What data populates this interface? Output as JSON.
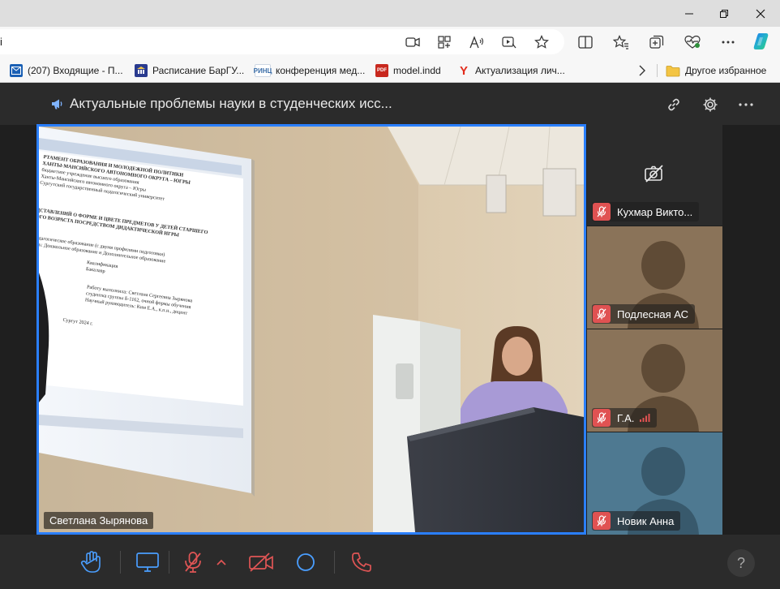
{
  "browser": {
    "address_text": "i",
    "window_controls": [
      "minimize",
      "maximize",
      "close"
    ],
    "toolbar_icons": [
      "video-icon",
      "apps-icon",
      "read-aloud-icon",
      "media-icon",
      "favorite-star-icon",
      "split-screen-icon",
      "favorites-icon",
      "collections-icon",
      "heart-pulse-icon",
      "more-icon",
      "copilot-icon"
    ]
  },
  "favorites": [
    {
      "label": "(207) Входящие - П...",
      "icon": "mail-icon",
      "color": "#1a5fb4"
    },
    {
      "label": "Расписание БарГУ...",
      "icon": "university-icon",
      "color": "#2a3b8f"
    },
    {
      "label": "конференция мед...",
      "icon": "rinc-icon",
      "color": "#3b6ea8"
    },
    {
      "label": "model.indd",
      "icon": "pdf-icon",
      "color": "#c8281e"
    },
    {
      "label": "Актуализация лич...",
      "icon": "yandex-icon",
      "color": "#e22b1b"
    }
  ],
  "favorites_other": "Другое избранное",
  "conference": {
    "title": "Актуальные проблемы науки в студенческих исс...",
    "accent": "#2a7fff"
  },
  "main_speaker": {
    "name": "Светлана Зырянова"
  },
  "slide_text": {
    "line1": "РТАМЕНТ ОБРАЗОВАНИЯ И МОЛОДЕЖНОЙ ПОЛИТИКИ",
    "line2": "ХАНТЫ-МАНСИЙСКОГО АВТОНОМНОГО ОКРУГА – ЮГРЫ",
    "line3": "бюджетное учреждение высшего образования",
    "line4": "Ханты-Мансийского автономного округа – Югры",
    "line5": "Сургутский государственный педагогический университет",
    "heading1": "ДСТАВЛЕНИЙ О ФОРМЕ И ЦВЕТЕ ПРЕДМЕТОВ У ДЕТЕЙ СТАРШЕГО",
    "heading2": "ОГО ВОЗРАСТА ПОСРЕДСТВОМ ДИДАКТИЧЕСКОЙ ИГРЫ",
    "line6": "Педагогическое образование (с двумя профилями подготовки)",
    "line7": "ость: Дошкольное образование и Дополнительное образование",
    "line8": "Квалификация",
    "line9": "Бакалавр",
    "line10": "Работу выполнила: Светлана Сергеевна Зырянова",
    "line11": "студентка группы Б-1162, очной формы обучения",
    "line12": "Научный руководитель: Ким Е.А., к.п.н., доцент",
    "line13": "Сургут 2024 г."
  },
  "participants": [
    {
      "name": "Кухмар Викто...",
      "video": "off",
      "muted": true
    },
    {
      "name": "Подлесная АС",
      "video": "avatar",
      "muted": true,
      "bg": "#8a7359"
    },
    {
      "name": "Г.А.",
      "video": "avatar",
      "muted": true,
      "bg": "#8a7359",
      "weak_signal": true
    },
    {
      "name": "Новик Анна",
      "video": "avatar",
      "muted": true,
      "bg": "#4e7991"
    }
  ],
  "toolbar": {
    "tools": [
      "raise-hand",
      "screen-share",
      "microphone",
      "camera",
      "background",
      "hang-up"
    ],
    "help_label": "?"
  },
  "colors": {
    "mute_red": "#e05252",
    "hangup_red": "#e05555",
    "tool_blue": "#4a9eff"
  }
}
